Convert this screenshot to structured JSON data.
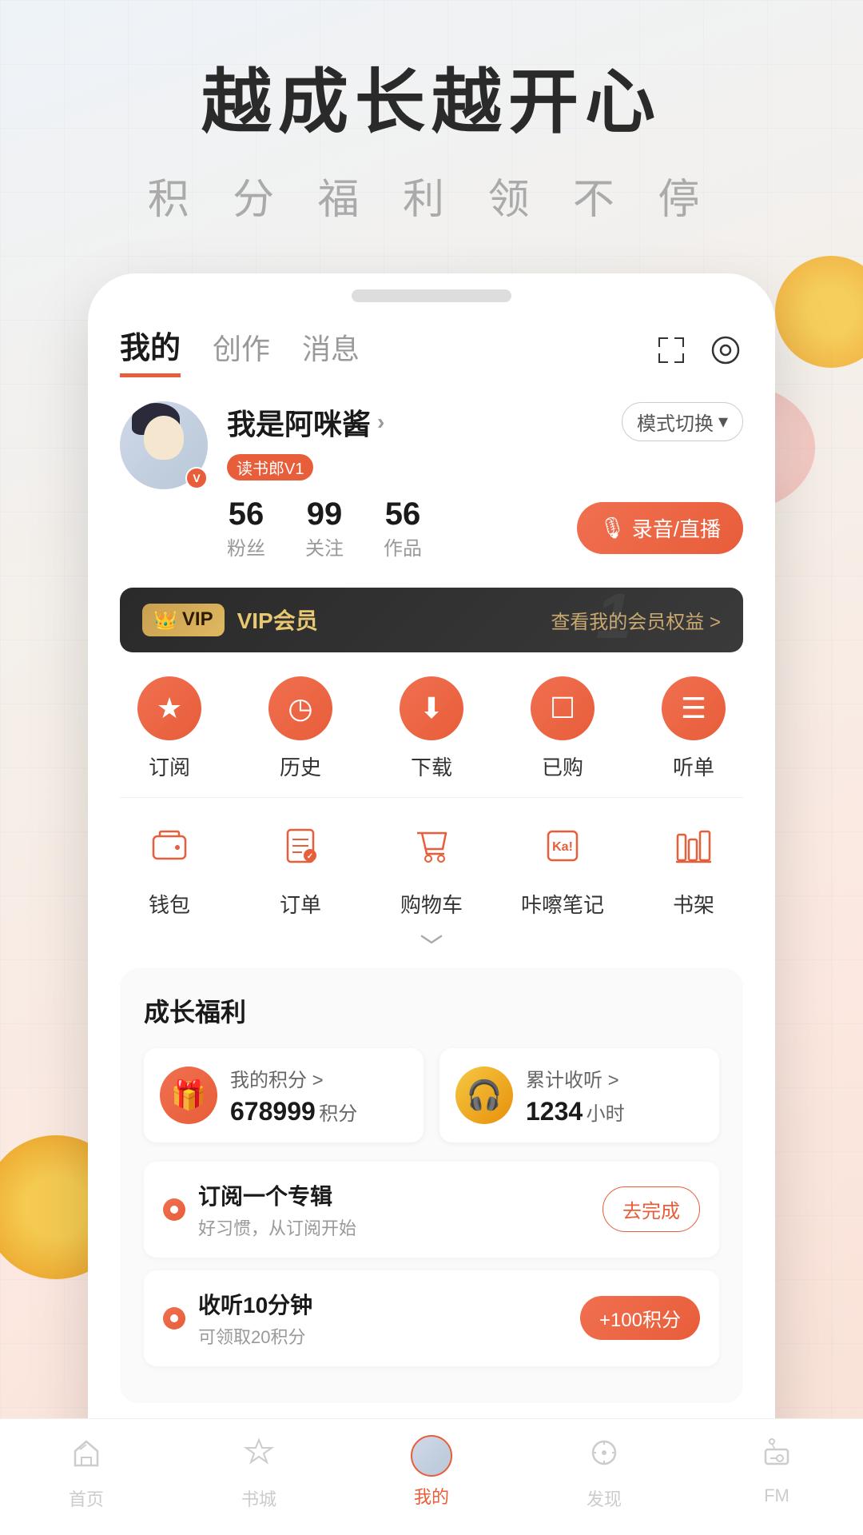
{
  "hero": {
    "title": "越成长越开心",
    "subtitle": "积 分 福 利 领 不 停"
  },
  "nav": {
    "tabs": [
      {
        "label": "我的",
        "active": true
      },
      {
        "label": "创作",
        "active": false
      },
      {
        "label": "消息",
        "active": false
      }
    ],
    "scan_icon": "⊡",
    "settings_icon": "◎"
  },
  "profile": {
    "name": "我是阿咪酱",
    "badge": "读书郎V1",
    "mode_switch": "模式切换",
    "stats": [
      {
        "num": "56",
        "label": "粉丝"
      },
      {
        "num": "99",
        "label": "关注"
      },
      {
        "num": "56",
        "label": "作品"
      }
    ],
    "record_btn": "录音/直播"
  },
  "vip": {
    "badge": "VIP",
    "label": "VIP会员",
    "link": "查看我的会员权益 >"
  },
  "quick_icons": [
    {
      "icon": "★",
      "label": "订阅"
    },
    {
      "icon": "◷",
      "label": "历史"
    },
    {
      "icon": "⬇",
      "label": "下载"
    },
    {
      "icon": "□",
      "label": "已购"
    },
    {
      "icon": "☰",
      "label": "听单"
    }
  ],
  "tool_icons": [
    {
      "icon": "💼",
      "label": "钱包"
    },
    {
      "icon": "📋",
      "label": "订单"
    },
    {
      "icon": "🛒",
      "label": "购物车"
    },
    {
      "icon": "Ka!",
      "label": "咔嚓笔记"
    },
    {
      "icon": "📚",
      "label": "书架"
    }
  ],
  "growth": {
    "title": "成长福利",
    "cards": [
      {
        "label": "我的积分 >",
        "num": "678999",
        "unit": "积分",
        "icon": "🎁",
        "icon_type": "pink"
      },
      {
        "label": "累计收听 >",
        "num": "1234",
        "unit": "小时",
        "icon": "🎧",
        "icon_type": "yellow"
      }
    ],
    "tasks": [
      {
        "name": "订阅一个专辑",
        "desc": "好习惯，从订阅开始",
        "btn": "去完成",
        "btn_type": "outline"
      },
      {
        "name": "收听10分钟",
        "desc": "可领取20积分",
        "btn": "+100积分",
        "btn_type": "filled"
      }
    ]
  },
  "bottom_nav": [
    {
      "icon": "📊",
      "label": "首页",
      "active": false
    },
    {
      "icon": "⭐",
      "label": "书城",
      "active": false
    },
    {
      "icon": "avatar",
      "label": "我的",
      "active": true
    },
    {
      "icon": "🔍",
      "label": "发现",
      "active": false
    },
    {
      "icon": "📻",
      "label": "FM",
      "active": false
    }
  ]
}
